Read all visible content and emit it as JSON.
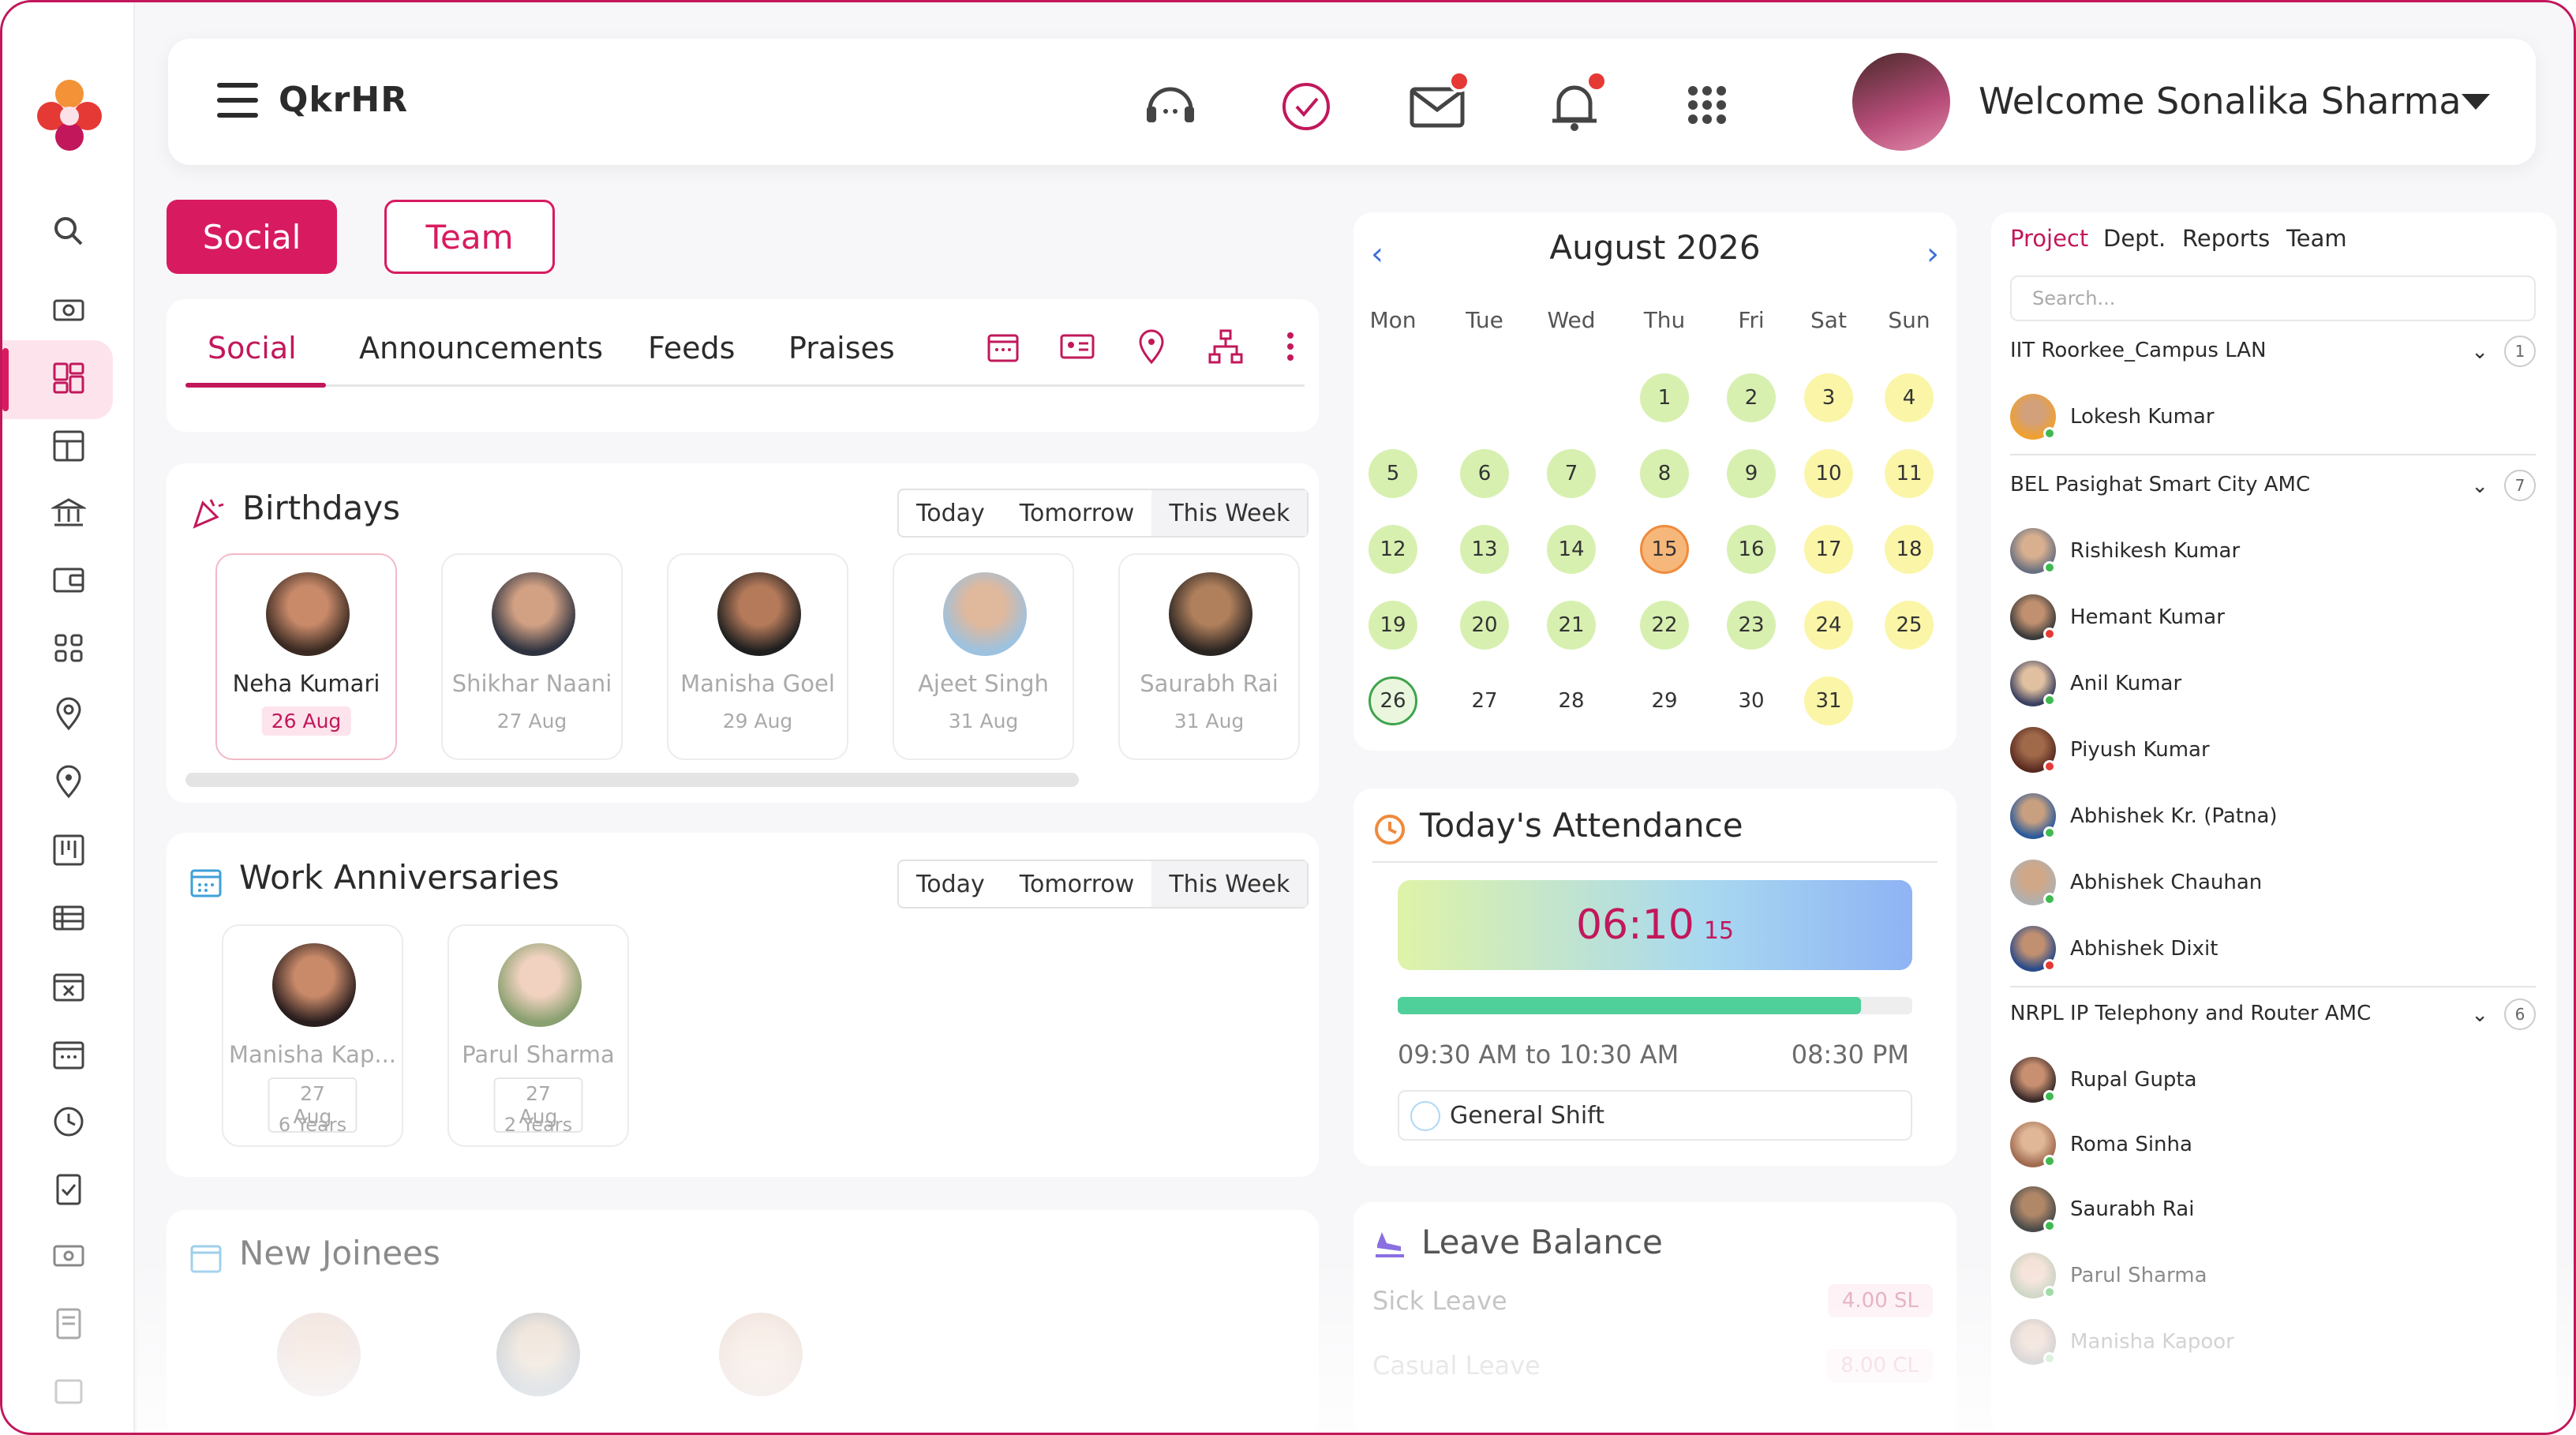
{
  "app": {
    "title": "QkrHR"
  },
  "header": {
    "welcome": "Welcome Sonalika Sharma"
  },
  "top_buttons": {
    "social": "Social",
    "team": "Team"
  },
  "tabs": [
    "Social",
    "Announcements",
    "Feeds",
    "Praises"
  ],
  "birthdays": {
    "title": "Birthdays",
    "filters": [
      "Today",
      "Tomorrow",
      "This Week"
    ],
    "people": [
      {
        "name": "Neha Kumari",
        "date": "26 Aug"
      },
      {
        "name": "Shikhar Naani",
        "date": "27 Aug"
      },
      {
        "name": "Manisha Goel",
        "date": "29 Aug"
      },
      {
        "name": "Ajeet Singh",
        "date": "31 Aug"
      },
      {
        "name": "Saurabh Rai",
        "date": "31 Aug"
      }
    ]
  },
  "anniversaries": {
    "title": "Work Anniversaries",
    "filters": [
      "Today",
      "Tomorrow",
      "This Week"
    ],
    "people": [
      {
        "name": "Manisha Kap...",
        "date": "27 Aug",
        "years": "6 Years"
      },
      {
        "name": "Parul Sharma",
        "date": "27 Aug",
        "years": "2 Years"
      }
    ]
  },
  "new_joinees": {
    "title": "New Joinees"
  },
  "calendar": {
    "title": "August 2026",
    "weekdays": [
      "Mon",
      "Tue",
      "Wed",
      "Thu",
      "Fri",
      "Sat",
      "Sun"
    ],
    "weeks": [
      [
        "",
        "",
        "",
        "1",
        "2",
        "3",
        "4"
      ],
      [
        "5",
        "6",
        "7",
        "8",
        "9",
        "10",
        "11"
      ],
      [
        "12",
        "13",
        "14",
        "15",
        "16",
        "17",
        "18"
      ],
      [
        "19",
        "20",
        "21",
        "22",
        "23",
        "24",
        "25"
      ],
      [
        "26",
        "27",
        "28",
        "29",
        "30",
        "31",
        ""
      ]
    ],
    "today": "15",
    "selected": "26"
  },
  "attendance": {
    "title": "Today's Attendance",
    "clock": "06:10",
    "seconds": "15",
    "progress_percent": 90,
    "range": "09:30 AM to 10:30 AM",
    "end": "08:30 PM",
    "shift": "General Shift"
  },
  "leave": {
    "title": "Leave Balance",
    "rows": [
      {
        "label": "Sick Leave",
        "value": "4.00 SL"
      },
      {
        "label": "Casual Leave",
        "value": "8.00 CL"
      }
    ]
  },
  "right_panel": {
    "tabs": [
      "Project",
      "Dept.",
      "Reports",
      "Team"
    ],
    "search_placeholder": "Search...",
    "groups": [
      {
        "name": "IIT Roorkee_Campus LAN",
        "count": "1",
        "members": [
          "Lokesh Kumar"
        ]
      },
      {
        "name": "BEL Pasighat Smart City AMC",
        "count": "7",
        "members": [
          "Rishikesh Kumar",
          "Hemant Kumar",
          "Anil Kumar",
          "Piyush Kumar",
          "Abhishek Kr. (Patna)",
          "Abhishek Chauhan",
          "Abhishek Dixit"
        ]
      },
      {
        "name": "NRPL IP Telephony and Router AMC",
        "count": "6",
        "members": [
          "Rupal Gupta",
          "Roma Sinha",
          "Saurabh Rai",
          "Parul Sharma",
          "Manisha Kapoor"
        ]
      }
    ]
  },
  "colors": {
    "accent": "#c2185b",
    "accent_bg": "#d81b60",
    "calendar_green": "#d7f0b0",
    "calendar_yellow": "#fbf5a8",
    "calendar_today": "#f6b77a"
  }
}
